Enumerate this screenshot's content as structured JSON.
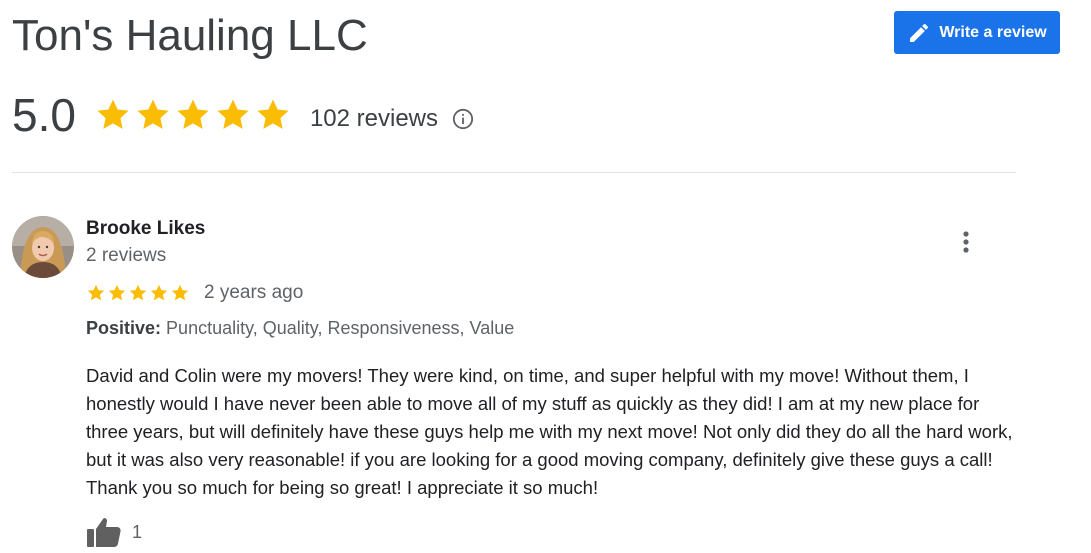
{
  "business": {
    "title": "Ton's Hauling LLC",
    "write_review_label": "Write a review"
  },
  "rating": {
    "value": "5.0",
    "stars": 5,
    "review_count": "102 reviews"
  },
  "review": {
    "reviewer_name": "Brooke Likes",
    "reviewer_review_count": "2 reviews",
    "stars": 5,
    "date": "2 years ago",
    "attributes_label": "Positive:",
    "attributes_value": "Punctuality, Quality, Responsiveness, Value",
    "text": "David and Colin were my movers! They were kind, on time, and super helpful with my move! Without them, I honestly would I have never been able to move all of my stuff as quickly as they did! I am at my new place for three years, but will definitely have these guys help me with my next move! Not only did they do all the hard work, but it was also very reasonable! if you are looking for a good moving company, definitely give these guys a call! Thank you so much for being so great! I appreciate it so much!",
    "like_count": "1"
  },
  "colors": {
    "star": "#fbbc04",
    "button": "#1a73e8",
    "icon_gray": "#5f6368",
    "thumbs_gray": "#606060"
  },
  "icons": {
    "write_review": "pencil-icon",
    "info": "info-icon",
    "star": "star-icon",
    "more": "more-vert-icon",
    "like": "thumbs-up-icon"
  }
}
